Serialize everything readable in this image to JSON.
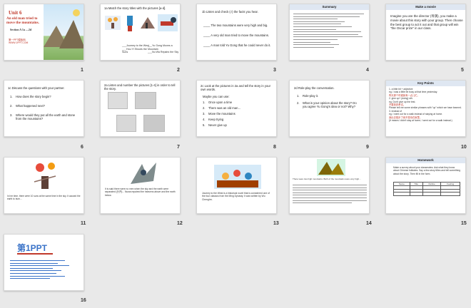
{
  "slides": [
    {
      "num": "1",
      "title": "Unit 6",
      "subtitle": "An old man tried to move the mountains.",
      "section": "Section A 1a —2d",
      "website": "第一PPT模板网-WWW.1PPT.COM"
    },
    {
      "num": "2",
      "heading": "1a Match the story titles with the pictures [a-d].",
      "items": [
        "___Journey to the West",
        "___Yu Gong Moves a Mountain",
        "___Hou Yi Shoots the Suns",
        "___Nu Wa Repairs the Sky"
      ],
      "labels": [
        "a",
        "b",
        "c",
        "d"
      ]
    },
    {
      "num": "3",
      "heading": "1b Listen and check (√) the facts you hear.",
      "items": [
        "____ The two mountains were very high and big.",
        "____ A very old man tried to move the mountains.",
        "____ A man told Yu Gong that he could never do it."
      ]
    },
    {
      "num": "4",
      "heading": "Summary"
    },
    {
      "num": "5",
      "heading": "Make a movie",
      "body": "Imagine you are the director (导演), you make a movie about this story with your group. Then choose the best group to act it out and that group will win \"the Oscar prize\" in our class."
    },
    {
      "num": "6",
      "heading": "1c Discuss the questions with your partner.",
      "questions": [
        "How does the story begin?",
        "What happened next?",
        "Where would they put all the earth and stone from the mountains?"
      ]
    },
    {
      "num": "7",
      "heading": "2a Listen and number the pictures [1-4] in order to tell the story."
    },
    {
      "num": "8",
      "heading": "2c Look at the pictures in 2a and tell the story in your own words.",
      "lead": "Maybe you can use:",
      "phrases": [
        "Once upon a time",
        "There was an old man…",
        "Move the mountains",
        "Keep trying",
        "Never give up"
      ]
    },
    {
      "num": "9",
      "heading": "2d Role-play the conversation.",
      "tasks": [
        "Role-play it.",
        "What is your opinion about the story? Do you agree Yu Gong's idea or not? Why?"
      ]
    },
    {
      "num": "10",
      "heading": "Key Points",
      "points": [
        "1. a little bit + adjective",
        "eg. I was a little bit busy at that time yesterday.",
        "昨天那个时候我有一点儿忙。",
        "2. give up+ (doing) sth.",
        "eg. Don't give up the test.",
        "不要放弃考试。",
        "Please tell me some similar phrases with \"up\" which we have learned.",
        "3. instead of",
        "eg. I went out for a walk instead of staying at home.",
        "我出去散步了而不是待在家里。",
        "(It means I didn't stay at home; I went out for a walk instead.)"
      ]
    },
    {
      "num": "11",
      "caption": "In her time, there were 10 suns at the same time in the sky. It caused the earth to burn..."
    },
    {
      "num": "12",
      "caption": "It is said there were no men when the sky and the earth were separated (分开)... Nuwa repaired the heavens above and the earth below."
    },
    {
      "num": "13",
      "caption": "Journey to the West is a historical novel that is considered one of the four classics from the Ming Dynasty. It was written by Wu Cheng'en."
    },
    {
      "num": "14",
      "caption": "There were two high mountains. Both of the mountains were very high..."
    },
    {
      "num": "15",
      "heading": "Homework",
      "body": "Make a survey about your classmates. Ask what they know about Chinese folktales. Say a few story titles and tell something about the story. Then fill in the form.",
      "table_headers": [
        "Name",
        "Title",
        "Outline",
        "Feeling"
      ]
    },
    {
      "num": "16",
      "logo": "第1PPT"
    }
  ],
  "colors": {
    "accent_red": "#c0392b",
    "accent_blue": "#3a73c8",
    "header_bg": "#dfe7f2"
  }
}
